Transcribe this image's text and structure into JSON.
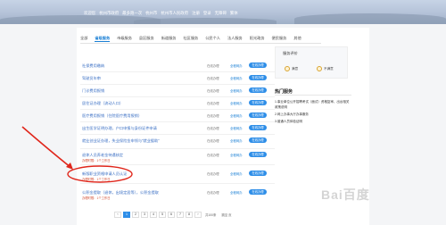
{
  "header": {
    "nav": [
      "欢迎您",
      "杭州市政府",
      "最多跑一次",
      "杭州市",
      "杭州市人民政府",
      "注册",
      "登录",
      "无障碍",
      "繁体"
    ]
  },
  "tabs": [
    "全部",
    "省级服务",
    "市级服务",
    "县区服务",
    "街道服务",
    "社区服务",
    "公民个人",
    "法人服务",
    "阳光政务",
    "便民服务",
    "其他"
  ],
  "active_tab_index": 1,
  "rows": [
    {
      "title": "社保费用缴纳",
      "sub": "",
      "status": "在线办理",
      "tag": "全程网办",
      "button": "在线办理"
    },
    {
      "title": "驾驶员年审",
      "sub": "",
      "status": "在线办理",
      "tag": "全程网办",
      "button": "在线办理"
    },
    {
      "title": "门诊费用报销",
      "sub": "",
      "status": "在线办理",
      "tag": "全程网办",
      "button": "在线办理"
    },
    {
      "title": "居住证办理（流动人口）",
      "sub": "",
      "status": "在线办理",
      "tag": "全程网办",
      "button": "在线办理"
    },
    {
      "title": "医疗费用报销（住院医疗费用报销）",
      "sub": "",
      "status": "在线办理",
      "tag": "全程网办",
      "button": "在线办理"
    },
    {
      "title": "出生医学证明办理，户口申报与身份证件申请",
      "sub": "",
      "status": "在线办理",
      "tag": "全程网办",
      "button": "在线办理"
    },
    {
      "title": "就业创业证办理，失业保险金申领与“就业援助”",
      "sub": "",
      "status": "在线办理",
      "tag": "全程网办",
      "button": "在线办理"
    },
    {
      "title": "退休人员养老金待遇核定",
      "sub": "办理时限：1个工作日",
      "status": "在线办理",
      "tag": "全程网办",
      "button": "在线办理"
    },
    {
      "title": "新版职业资格申请人员认证",
      "sub": "办理时限：1个工作日",
      "status": "在线办理",
      "tag": "全程网办",
      "button": "在线办理"
    },
    {
      "title": "公积金提取（退休，出境定居等），公积金提取",
      "sub": "办理时限：1个工作日",
      "status": "在线办理",
      "tag": "全程网办",
      "button": "在线办理"
    }
  ],
  "card": {
    "title": "服务评价",
    "options": [
      "满意",
      "不满意"
    ]
  },
  "hot": {
    "title": "热门服务",
    "items": [
      "1.事业单位公开招聘考试（面试）资格复审，出台相关政策说明",
      "2.网上办事大厅办事服务",
      "3.普通人员体检证明"
    ]
  },
  "pager": {
    "pages": [
      "1",
      "2",
      "3",
      "4",
      "5",
      "6",
      "7",
      "8"
    ],
    "current": "1",
    "prev": "‹",
    "next": "›",
    "total": "共100条",
    "goto": "跳至 页"
  },
  "watermark": "Bai百度"
}
